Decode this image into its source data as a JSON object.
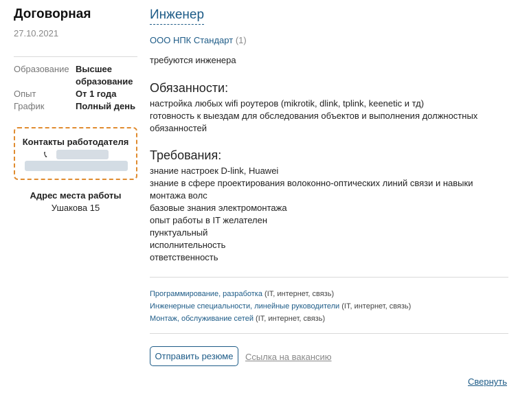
{
  "salary": "Договорная",
  "date": "27.10.2021",
  "properties": [
    {
      "label": "Образование",
      "value": "Высшее образование"
    },
    {
      "label": "Опыт",
      "value": "От 1 года"
    },
    {
      "label": "График",
      "value": "Полный день"
    }
  ],
  "contacts": {
    "title": "Контакты работодателя",
    "phone_icon": "phone-icon"
  },
  "address": {
    "title": "Адрес места работы",
    "value": "Ушакова 15"
  },
  "job": {
    "title": "Инженер",
    "company": "ООО НПК Стандарт",
    "company_count": "(1)",
    "description": "требуются инженера"
  },
  "duties": {
    "title": "Обязанности:",
    "items": [
      "настройка любых wifi роутеров (mikrotik, dlink, tplink, keenetic и тд)",
      "готовность к выездам для обследования объектов и выполнения должностных обязанностей"
    ]
  },
  "requirements": {
    "title": "Требования:",
    "items": [
      "знание настроек D-link, Huawei",
      "знание в сфере проектирования волоконно-оптических линий связи и навыки монтажа волс",
      "базовые знания электромонтажа",
      "опыт работы в IT желателен",
      "пунктуальный",
      "исполнительность",
      "ответственность"
    ]
  },
  "categories": [
    {
      "link": "Программирование, разработка",
      "suffix": "(IT, интернет, связь)"
    },
    {
      "link": "Инженерные специальности, линейные руководители",
      "suffix": "(IT, интернет, связь)"
    },
    {
      "link": "Монтаж, обслуживание сетей",
      "suffix": "(IT, интернет, связь)"
    }
  ],
  "actions": {
    "send_resume": "Отправить резюме",
    "vacancy_link": "Ссылка на вакансию",
    "collapse": "Свернуть"
  },
  "colors": {
    "link": "#1d5b87",
    "contact_border": "#e08b2f"
  }
}
